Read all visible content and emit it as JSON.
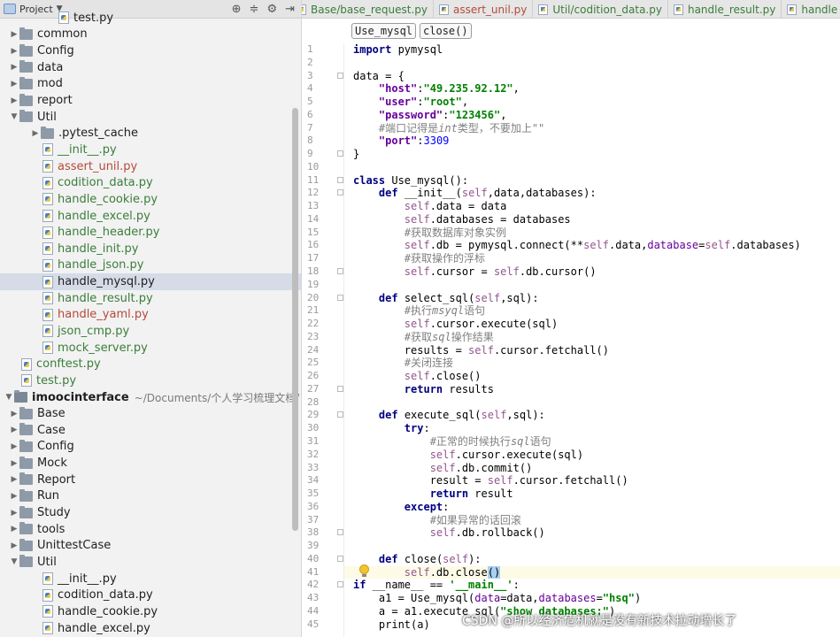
{
  "sidebar": {
    "title": "Project",
    "items": [
      {
        "label": "test.py",
        "kind": "file",
        "level": 3,
        "color": "plain",
        "partial": true
      },
      {
        "label": "common",
        "kind": "folder",
        "level": 1,
        "color": "plain",
        "expanded": false
      },
      {
        "label": "Config",
        "kind": "folder",
        "level": 1,
        "color": "plain",
        "expanded": false
      },
      {
        "label": "data",
        "kind": "folder",
        "level": 1,
        "color": "plain",
        "expanded": false
      },
      {
        "label": "mod",
        "kind": "folder",
        "level": 1,
        "color": "plain",
        "expanded": false
      },
      {
        "label": "report",
        "kind": "folder",
        "level": 1,
        "color": "plain",
        "expanded": false
      },
      {
        "label": "Util",
        "kind": "folder",
        "level": 1,
        "color": "plain",
        "expanded": true
      },
      {
        "label": ".pytest_cache",
        "kind": "folder",
        "level": 2,
        "color": "plain",
        "expanded": false
      },
      {
        "label": "__init__.py",
        "kind": "file",
        "level": 2,
        "color": "green"
      },
      {
        "label": "assert_unil.py",
        "kind": "file",
        "level": 2,
        "color": "red"
      },
      {
        "label": "codition_data.py",
        "kind": "file",
        "level": 2,
        "color": "green"
      },
      {
        "label": "handle_cookie.py",
        "kind": "file",
        "level": 2,
        "color": "green"
      },
      {
        "label": "handle_excel.py",
        "kind": "file",
        "level": 2,
        "color": "green"
      },
      {
        "label": "handle_header.py",
        "kind": "file",
        "level": 2,
        "color": "green"
      },
      {
        "label": "handle_init.py",
        "kind": "file",
        "level": 2,
        "color": "green"
      },
      {
        "label": "handle_json.py",
        "kind": "file",
        "level": 2,
        "color": "green"
      },
      {
        "label": "handle_mysql.py",
        "kind": "file",
        "level": 2,
        "color": "plain",
        "selected": true
      },
      {
        "label": "handle_result.py",
        "kind": "file",
        "level": 2,
        "color": "green"
      },
      {
        "label": "handle_yaml.py",
        "kind": "file",
        "level": 2,
        "color": "red"
      },
      {
        "label": "json_cmp.py",
        "kind": "file",
        "level": 2,
        "color": "green"
      },
      {
        "label": "mock_server.py",
        "kind": "file",
        "level": 2,
        "color": "green"
      },
      {
        "label": "conftest.py",
        "kind": "file",
        "level": 1,
        "color": "green"
      },
      {
        "label": "test.py",
        "kind": "file",
        "level": 1,
        "color": "green"
      },
      {
        "label": "imoocinterface",
        "kind": "root",
        "level": 0,
        "color": "bold",
        "expanded": true,
        "path": "~/Documents/个人学习梳理文档/"
      },
      {
        "label": "Base",
        "kind": "folder",
        "level": 1,
        "color": "plain",
        "expanded": false
      },
      {
        "label": "Case",
        "kind": "folder",
        "level": 1,
        "color": "plain",
        "expanded": false
      },
      {
        "label": "Config",
        "kind": "folder",
        "level": 1,
        "color": "plain",
        "expanded": false
      },
      {
        "label": "Mock",
        "kind": "folder",
        "level": 1,
        "color": "plain",
        "expanded": false
      },
      {
        "label": "Report",
        "kind": "folder",
        "level": 1,
        "color": "plain",
        "expanded": false
      },
      {
        "label": "Run",
        "kind": "folder",
        "level": 1,
        "color": "plain",
        "expanded": false
      },
      {
        "label": "Study",
        "kind": "folder",
        "level": 1,
        "color": "plain",
        "expanded": false
      },
      {
        "label": "tools",
        "kind": "folder",
        "level": 1,
        "color": "plain",
        "expanded": false
      },
      {
        "label": "UnittestCase",
        "kind": "folder",
        "level": 1,
        "color": "plain",
        "expanded": false
      },
      {
        "label": "Util",
        "kind": "folder",
        "level": 1,
        "color": "plain",
        "expanded": true
      },
      {
        "label": "__init__.py",
        "kind": "file",
        "level": 2,
        "color": "plain"
      },
      {
        "label": "codition_data.py",
        "kind": "file",
        "level": 2,
        "color": "plain"
      },
      {
        "label": "handle_cookie.py",
        "kind": "file",
        "level": 2,
        "color": "plain"
      },
      {
        "label": "handle_excel.py",
        "kind": "file",
        "level": 2,
        "color": "plain"
      }
    ]
  },
  "tabs": [
    {
      "label": "Base/base_request.py",
      "color": "green"
    },
    {
      "label": "assert_unil.py",
      "color": "red"
    },
    {
      "label": "Util/codition_data.py",
      "color": "green"
    },
    {
      "label": "handle_result.py",
      "color": "green"
    },
    {
      "label": "handle",
      "color": "green"
    }
  ],
  "breadcrumb": [
    "Use_mysql",
    "close()"
  ],
  "watermark": "CSDN @所以经济危机就是没有新技术拉动增长了",
  "code_lines": [
    [
      [
        "kw",
        "import"
      ],
      [
        "t",
        " pymysql"
      ]
    ],
    [],
    [
      [
        "t",
        "data = {"
      ]
    ],
    [
      [
        "t",
        "    "
      ],
      [
        "key",
        "\"host\""
      ],
      [
        "t",
        ":"
      ],
      [
        "str",
        "\"49.235.92.12\""
      ],
      [
        "t",
        ","
      ]
    ],
    [
      [
        "t",
        "    "
      ],
      [
        "key",
        "\"user\""
      ],
      [
        "t",
        ":"
      ],
      [
        "str",
        "\"root\""
      ],
      [
        "t",
        ","
      ]
    ],
    [
      [
        "t",
        "    "
      ],
      [
        "key",
        "\"password\""
      ],
      [
        "t",
        ":"
      ],
      [
        "str",
        "\"123456\""
      ],
      [
        "t",
        ","
      ]
    ],
    [
      [
        "t",
        "    "
      ],
      [
        "cmtcn",
        "#端口记得是"
      ],
      [
        "cmt",
        "int"
      ],
      [
        "cmtcn",
        "类型，不要加上\"\""
      ]
    ],
    [
      [
        "t",
        "    "
      ],
      [
        "key",
        "\"port\""
      ],
      [
        "t",
        ":"
      ],
      [
        "num",
        "3309"
      ]
    ],
    [
      [
        "t",
        "}"
      ]
    ],
    [],
    [
      [
        "kw",
        "class"
      ],
      [
        "t",
        " Use_mysql():"
      ]
    ],
    [
      [
        "t",
        "    "
      ],
      [
        "kw",
        "def"
      ],
      [
        "t",
        " __init__("
      ],
      [
        "selfkw",
        "self"
      ],
      [
        "t",
        ",data,databases):"
      ]
    ],
    [
      [
        "t",
        "        "
      ],
      [
        "selfkw",
        "self"
      ],
      [
        "t",
        ".data = data"
      ]
    ],
    [
      [
        "t",
        "        "
      ],
      [
        "selfkw",
        "self"
      ],
      [
        "t",
        ".databases = databases"
      ]
    ],
    [
      [
        "t",
        "        "
      ],
      [
        "cmtcn",
        "#获取数据库对象实例"
      ]
    ],
    [
      [
        "t",
        "        "
      ],
      [
        "selfkw",
        "self"
      ],
      [
        "t",
        ".db = pymysql.connect(**"
      ],
      [
        "selfkw",
        "self"
      ],
      [
        "t",
        ".data,"
      ],
      [
        "param",
        "database"
      ],
      [
        "t",
        "="
      ],
      [
        "selfkw",
        "self"
      ],
      [
        "t",
        ".databases)"
      ]
    ],
    [
      [
        "t",
        "        "
      ],
      [
        "cmtcn",
        "#获取操作的浮标"
      ]
    ],
    [
      [
        "t",
        "        "
      ],
      [
        "selfkw",
        "self"
      ],
      [
        "t",
        ".cursor = "
      ],
      [
        "selfkw",
        "self"
      ],
      [
        "t",
        ".db.cursor()"
      ]
    ],
    [],
    [
      [
        "t",
        "    "
      ],
      [
        "kw",
        "def"
      ],
      [
        "t",
        " select_sql("
      ],
      [
        "selfkw",
        "self"
      ],
      [
        "t",
        ",sql):"
      ]
    ],
    [
      [
        "t",
        "        "
      ],
      [
        "cmtcn",
        "#执行"
      ],
      [
        "cmt",
        "msyql"
      ],
      [
        "cmtcn",
        "语句"
      ]
    ],
    [
      [
        "t",
        "        "
      ],
      [
        "selfkw",
        "self"
      ],
      [
        "t",
        ".cursor.execute(sql)"
      ]
    ],
    [
      [
        "t",
        "        "
      ],
      [
        "cmtcn",
        "#获取"
      ],
      [
        "cmt",
        "sql"
      ],
      [
        "cmtcn",
        "操作结果"
      ]
    ],
    [
      [
        "t",
        "        results = "
      ],
      [
        "selfkw",
        "self"
      ],
      [
        "t",
        ".cursor.fetchall()"
      ]
    ],
    [
      [
        "t",
        "        "
      ],
      [
        "cmtcn",
        "#关闭连接"
      ]
    ],
    [
      [
        "t",
        "        "
      ],
      [
        "selfkw",
        "self"
      ],
      [
        "t",
        ".close()"
      ]
    ],
    [
      [
        "t",
        "        "
      ],
      [
        "kw",
        "return"
      ],
      [
        "t",
        " results"
      ]
    ],
    [],
    [
      [
        "t",
        "    "
      ],
      [
        "kw",
        "def"
      ],
      [
        "t",
        " execute_sql("
      ],
      [
        "selfkw",
        "self"
      ],
      [
        "t",
        ",sql):"
      ]
    ],
    [
      [
        "t",
        "        "
      ],
      [
        "kw",
        "try"
      ],
      [
        "t",
        ":"
      ]
    ],
    [
      [
        "t",
        "            "
      ],
      [
        "cmtcn",
        "#正常的时候执行"
      ],
      [
        "cmt",
        "sql"
      ],
      [
        "cmtcn",
        "语句"
      ]
    ],
    [
      [
        "t",
        "            "
      ],
      [
        "selfkw",
        "self"
      ],
      [
        "t",
        ".cursor.execute(sql)"
      ]
    ],
    [
      [
        "t",
        "            "
      ],
      [
        "selfkw",
        "self"
      ],
      [
        "t",
        ".db.commit()"
      ]
    ],
    [
      [
        "t",
        "            result = "
      ],
      [
        "selfkw",
        "self"
      ],
      [
        "t",
        ".cursor.fetchall()"
      ]
    ],
    [
      [
        "t",
        "            "
      ],
      [
        "kw",
        "return"
      ],
      [
        "t",
        " result"
      ]
    ],
    [
      [
        "t",
        "        "
      ],
      [
        "kw",
        "except"
      ],
      [
        "t",
        ":"
      ]
    ],
    [
      [
        "t",
        "            "
      ],
      [
        "cmtcn",
        "#如果异常的话回滚"
      ]
    ],
    [
      [
        "t",
        "            "
      ],
      [
        "selfkw",
        "self"
      ],
      [
        "t",
        ".db.rollback()"
      ]
    ],
    [],
    [
      [
        "t",
        "    "
      ],
      [
        "kw",
        "def"
      ],
      [
        "t",
        " close("
      ],
      [
        "selfkw",
        "self"
      ],
      [
        "t",
        "):"
      ]
    ],
    [
      [
        "t",
        "        "
      ],
      [
        "selfkw",
        "self"
      ],
      [
        "t",
        ".db.close"
      ],
      [
        "hl",
        "()"
      ]
    ],
    [
      [
        "kw",
        "if"
      ],
      [
        "t",
        " __name__ == "
      ],
      [
        "str",
        "'__main__'"
      ],
      [
        "t",
        ":"
      ]
    ],
    [
      [
        "t",
        "    a1 = Use_mysql("
      ],
      [
        "param",
        "data"
      ],
      [
        "t",
        "=data,"
      ],
      [
        "param",
        "databases"
      ],
      [
        "t",
        "="
      ],
      [
        "str",
        "\"hsq\""
      ],
      [
        "t",
        ")"
      ]
    ],
    [
      [
        "t",
        "    a = a1.execute_sql("
      ],
      [
        "str",
        "\"show databases;\""
      ],
      [
        "t",
        ")"
      ]
    ],
    [
      [
        "t",
        "    print(a)"
      ]
    ]
  ],
  "current_line": 41,
  "colors": {
    "green_file": "#3b7d3b",
    "red_file": "#b54a3b",
    "keyword": "#000080",
    "string": "#008000",
    "comment": "#808080",
    "self": "#94558d",
    "number": "#0000ff"
  }
}
